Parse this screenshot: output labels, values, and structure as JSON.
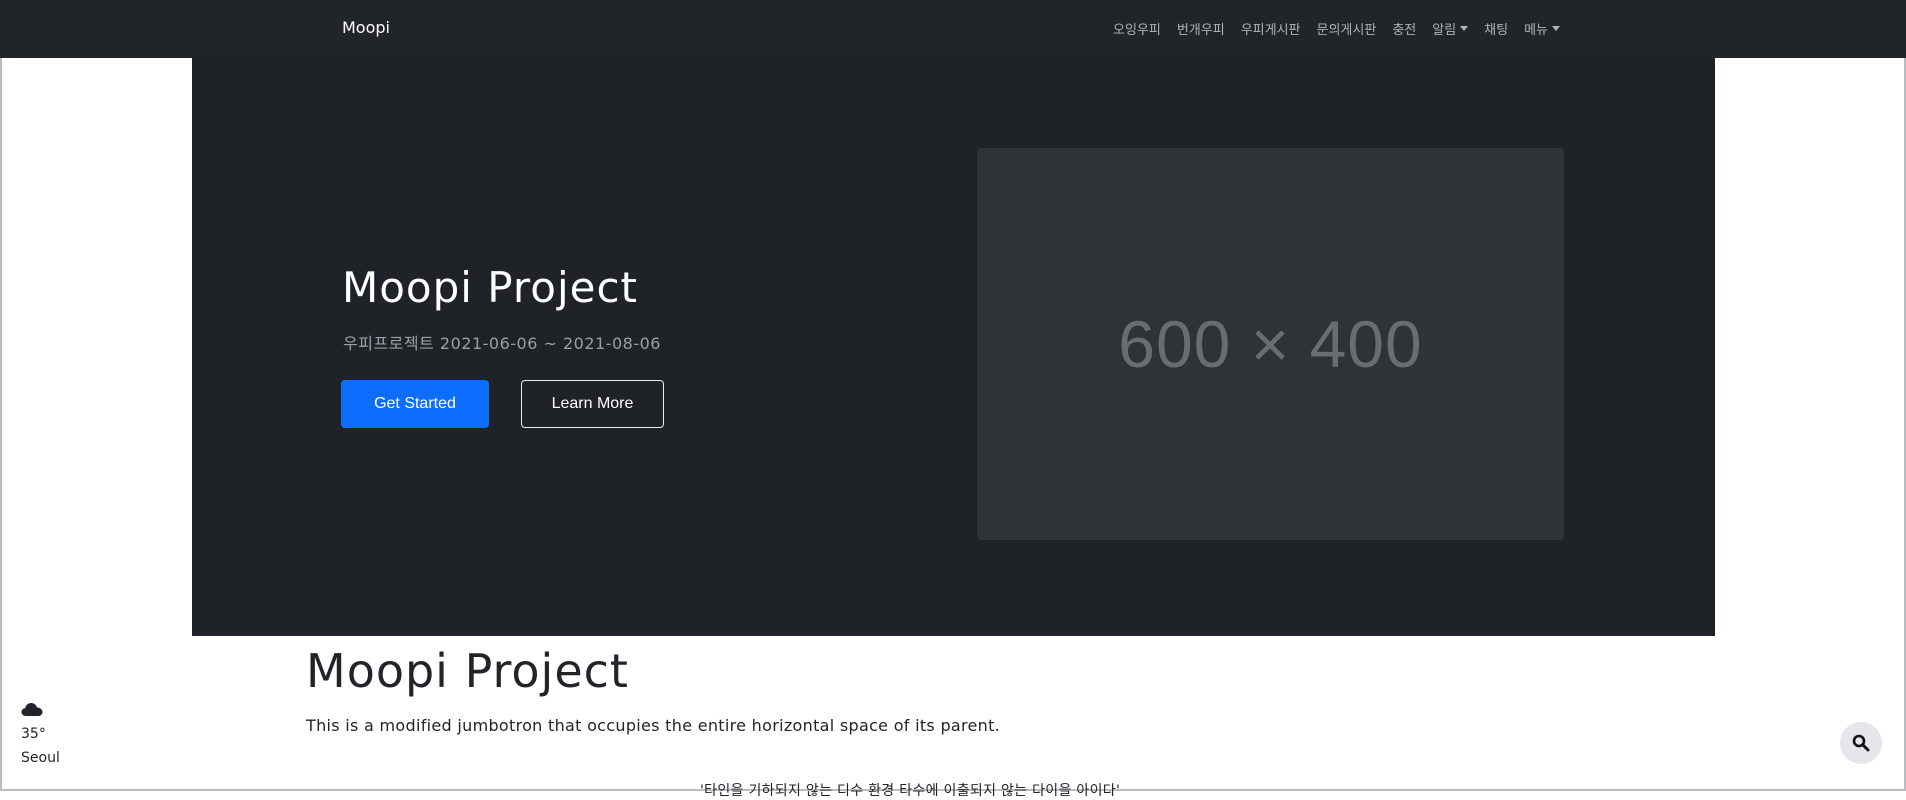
{
  "navbar": {
    "brand": "Moopi",
    "links": [
      {
        "label": "오잉우피",
        "dropdown": false
      },
      {
        "label": "번개우피",
        "dropdown": false
      },
      {
        "label": "우피게시판",
        "dropdown": false
      },
      {
        "label": "문의게시판",
        "dropdown": false
      },
      {
        "label": "충전",
        "dropdown": false
      },
      {
        "label": "알림",
        "dropdown": true
      },
      {
        "label": "채팅",
        "dropdown": false
      },
      {
        "label": "메뉴",
        "dropdown": true
      }
    ]
  },
  "hero": {
    "title": "Moopi Project",
    "subtitle": "우피프로젝트 2021-06-06 ~ 2021-08-06",
    "primary_button": "Get Started",
    "secondary_button": "Learn More",
    "image_placeholder": "600 × 400"
  },
  "content": {
    "title": "Moopi Project",
    "lead": "This is a modified jumbotron that occupies the entire horizontal space of its parent.",
    "quote": "'타인을 기하되지 않는 디수 환경 타수에 이출되지 않는 다이을 아이다'"
  },
  "weather": {
    "icon": "cloud-icon",
    "temperature": "35°",
    "city": "Seoul"
  },
  "search": {
    "icon": "search-icon"
  },
  "colors": {
    "navbar_bg": "#212529",
    "hero_bg": "#1f2227",
    "primary": "#0d6efd",
    "placeholder_bg": "#2f3337"
  }
}
